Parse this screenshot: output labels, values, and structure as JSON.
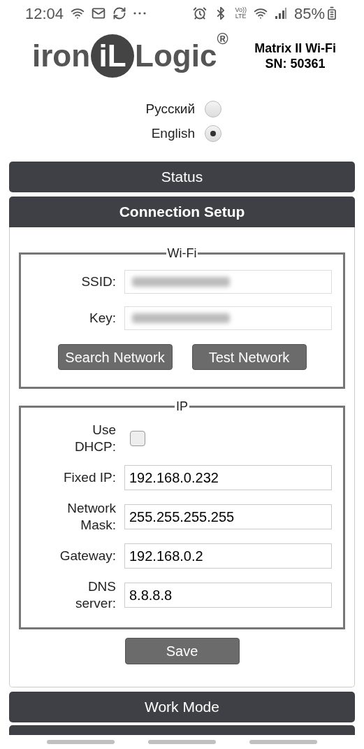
{
  "status_bar": {
    "time": "12:04",
    "volte": [
      "Vo))",
      "LTE"
    ],
    "battery": "85%"
  },
  "header": {
    "logo": {
      "left": "iron",
      "mark": "iL",
      "right": "Logic",
      "registered": "®"
    },
    "device": "Matrix II Wi-Fi",
    "serial": "SN: 50361"
  },
  "languages": [
    {
      "label": "Русский",
      "selected": false
    },
    {
      "label": "English",
      "selected": true
    }
  ],
  "sections": [
    {
      "title": "Status",
      "expanded": false
    },
    {
      "title": "Connection Setup",
      "expanded": true
    }
  ],
  "wifi": {
    "legend": "Wi-Fi",
    "fields": [
      {
        "label": "SSID:",
        "redacted": true
      },
      {
        "label": "Key:",
        "redacted": true
      }
    ],
    "buttons": [
      "Search Network",
      "Test Network"
    ]
  },
  "ip": {
    "legend": "IP",
    "dhcp": {
      "label": [
        "Use",
        "DHCP:"
      ],
      "checked": false
    },
    "fields": [
      {
        "label": [
          "Fixed IP:"
        ],
        "value": "192.168.0.232"
      },
      {
        "label": [
          "Network",
          "Mask:"
        ],
        "value": "255.255.255.255"
      },
      {
        "label": [
          "Gateway:"
        ],
        "value": "192.168.0.2"
      },
      {
        "label": [
          "DNS",
          "server:"
        ],
        "value": "8.8.8.8"
      }
    ]
  },
  "save": "Save",
  "after_sections": [
    {
      "title": "Work Mode"
    }
  ]
}
